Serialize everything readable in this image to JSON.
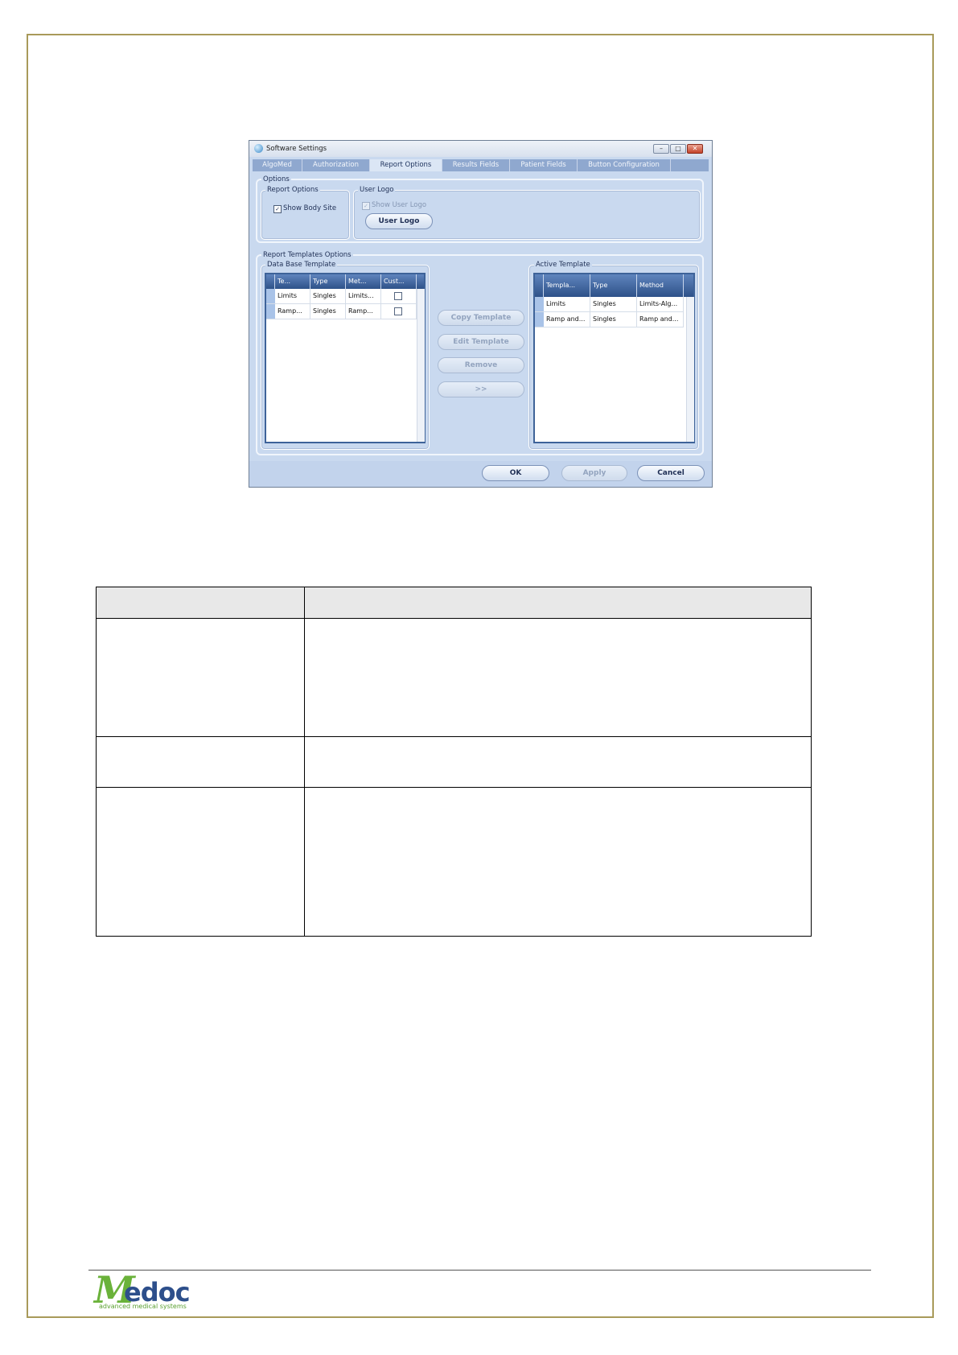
{
  "dialog": {
    "title": "Software Settings",
    "window_buttons": {
      "minimize": "–",
      "maximize": "□",
      "close": "✕"
    },
    "tabs": [
      {
        "label": "AlgoMed",
        "active": false
      },
      {
        "label": "Authorization",
        "active": false
      },
      {
        "label": "Report Options",
        "active": true
      },
      {
        "label": "Results Fields",
        "active": false
      },
      {
        "label": "Patient Fields",
        "active": false
      },
      {
        "label": "Button Configuration",
        "active": false
      }
    ],
    "options": {
      "group_label": "Options",
      "report_options_label": "Report Options",
      "show_body_site_label": "Show Body Site",
      "show_body_site_checked": true,
      "user_logo_label": "User Logo",
      "show_user_logo_label": "Show User Logo",
      "show_user_logo_checked": true,
      "user_logo_button": "User Logo"
    },
    "templates": {
      "group_label": "Report Templates Options",
      "database_label": "Data Base Template",
      "database_columns": [
        "Te...",
        "Type",
        "Met...",
        "Cust..."
      ],
      "database_rows": [
        {
          "template": "Limits",
          "type": "Singles",
          "method": "Limits...",
          "custom": false
        },
        {
          "template": "Ramp...",
          "type": "Singles",
          "method": "Ramp...",
          "custom": false
        }
      ],
      "active_label": "Active Template",
      "active_columns": [
        "Templa...",
        "Type",
        "Method"
      ],
      "active_rows": [
        {
          "template": "Limits",
          "type": "Singles",
          "method": "Limits-Alg..."
        },
        {
          "template": "Ramp and...",
          "type": "Singles",
          "method": "Ramp and..."
        }
      ],
      "buttons": {
        "copy": "Copy Template",
        "edit": "Edit Template",
        "remove": "Remove",
        "move": ">>"
      }
    },
    "footer_buttons": {
      "ok": "OK",
      "apply": "Apply",
      "cancel": "Cancel"
    }
  },
  "colors": {
    "page_border": "#a89a5a",
    "dialog_background": "#c9d9ef",
    "grid_header": "#2e5289",
    "logo_green": "#6ab23a",
    "logo_blue": "#2d4f8b"
  },
  "logo": {
    "first_letter": "M",
    "rest": "edoc",
    "tagline": "advanced medical systems"
  }
}
